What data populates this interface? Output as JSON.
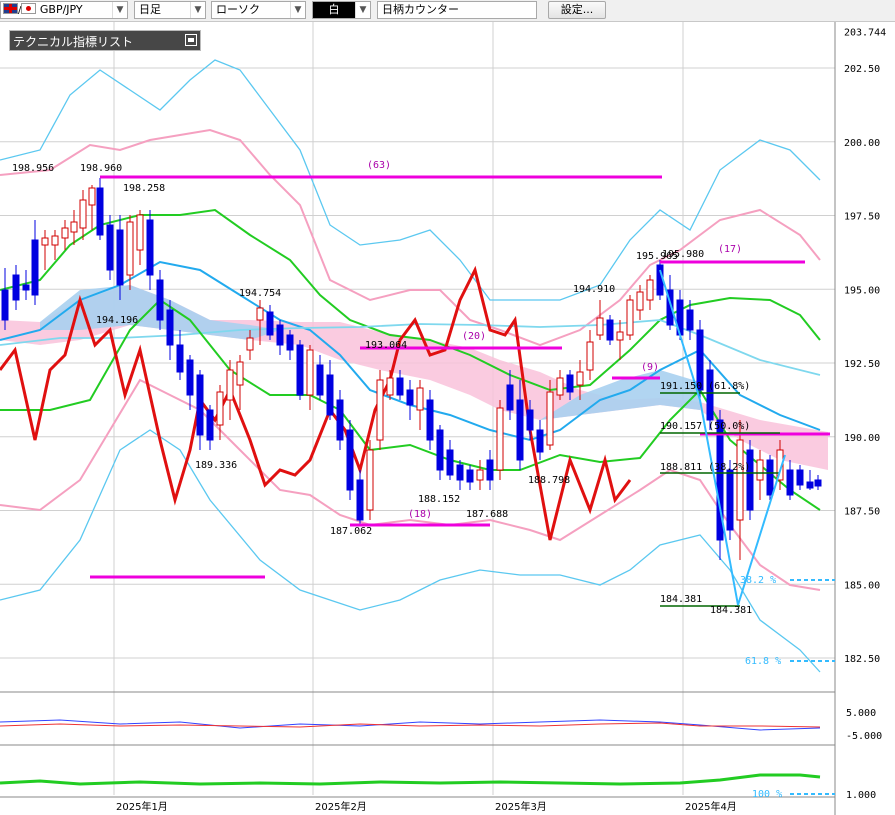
{
  "toolbar": {
    "symbol": "GBP/JPY",
    "period": "日足",
    "chart_style": "ローソク",
    "color_style": "白",
    "counter": "日柄カウンター",
    "settings": "設定..."
  },
  "legend": {
    "title": "テクニカル指標リスト"
  },
  "colors": {
    "bull_candle": "#d00000",
    "bear_candle": "#0000e0",
    "bollinger_outer": "#5bc8f0",
    "bollinger_inner": "#f5a0c0",
    "mid_band": "#22cc22",
    "ichimoku_base": "#22aaee",
    "ichimoku_lead": "#7fd8ee",
    "cloud_up": "#f9c2da",
    "cloud_down": "#a8d0f0",
    "rsi": "#e01010",
    "magenta": "#ee00dd",
    "fib": "#006600"
  },
  "chart_data": {
    "type": "candlestick",
    "yaxis": {
      "labels": [
        "203.744",
        "202.50",
        "200.00",
        "197.50",
        "195.00",
        "192.50",
        "190.00",
        "187.50",
        "185.00",
        "182.50"
      ],
      "values": [
        203.744,
        202.5,
        200,
        197.5,
        195,
        192.5,
        190,
        187.5,
        185,
        182.5
      ]
    },
    "xaxis": {
      "labels": [
        "2025年1月",
        "2025年2月",
        "2025年3月",
        "2025年4月"
      ]
    },
    "price_labels": [
      "198.956",
      "198.960",
      "198.258",
      "194.196",
      "194.754",
      "189.336",
      "193.064",
      "187.062",
      "188.152",
      "187.688",
      "188.798",
      "194.910",
      "195.965",
      "195.980",
      "184.381",
      "184.381"
    ],
    "counter_labels": [
      "(63)",
      "(20)",
      "(18)",
      "(17)",
      "(9)"
    ],
    "fibonacci": {
      "labels": [
        "191.150 (61.8%)",
        "190.157 (50.0%)",
        "188.811 (38.2%)",
        "184.381"
      ],
      "values": [
        191.15,
        190.157,
        188.811,
        184.381
      ]
    },
    "target_labels": [
      "38.2 %",
      "61.8 %",
      "100 %"
    ],
    "sub_axis": {
      "labels": [
        "5.000",
        "-5.000",
        "1.000"
      ]
    }
  }
}
